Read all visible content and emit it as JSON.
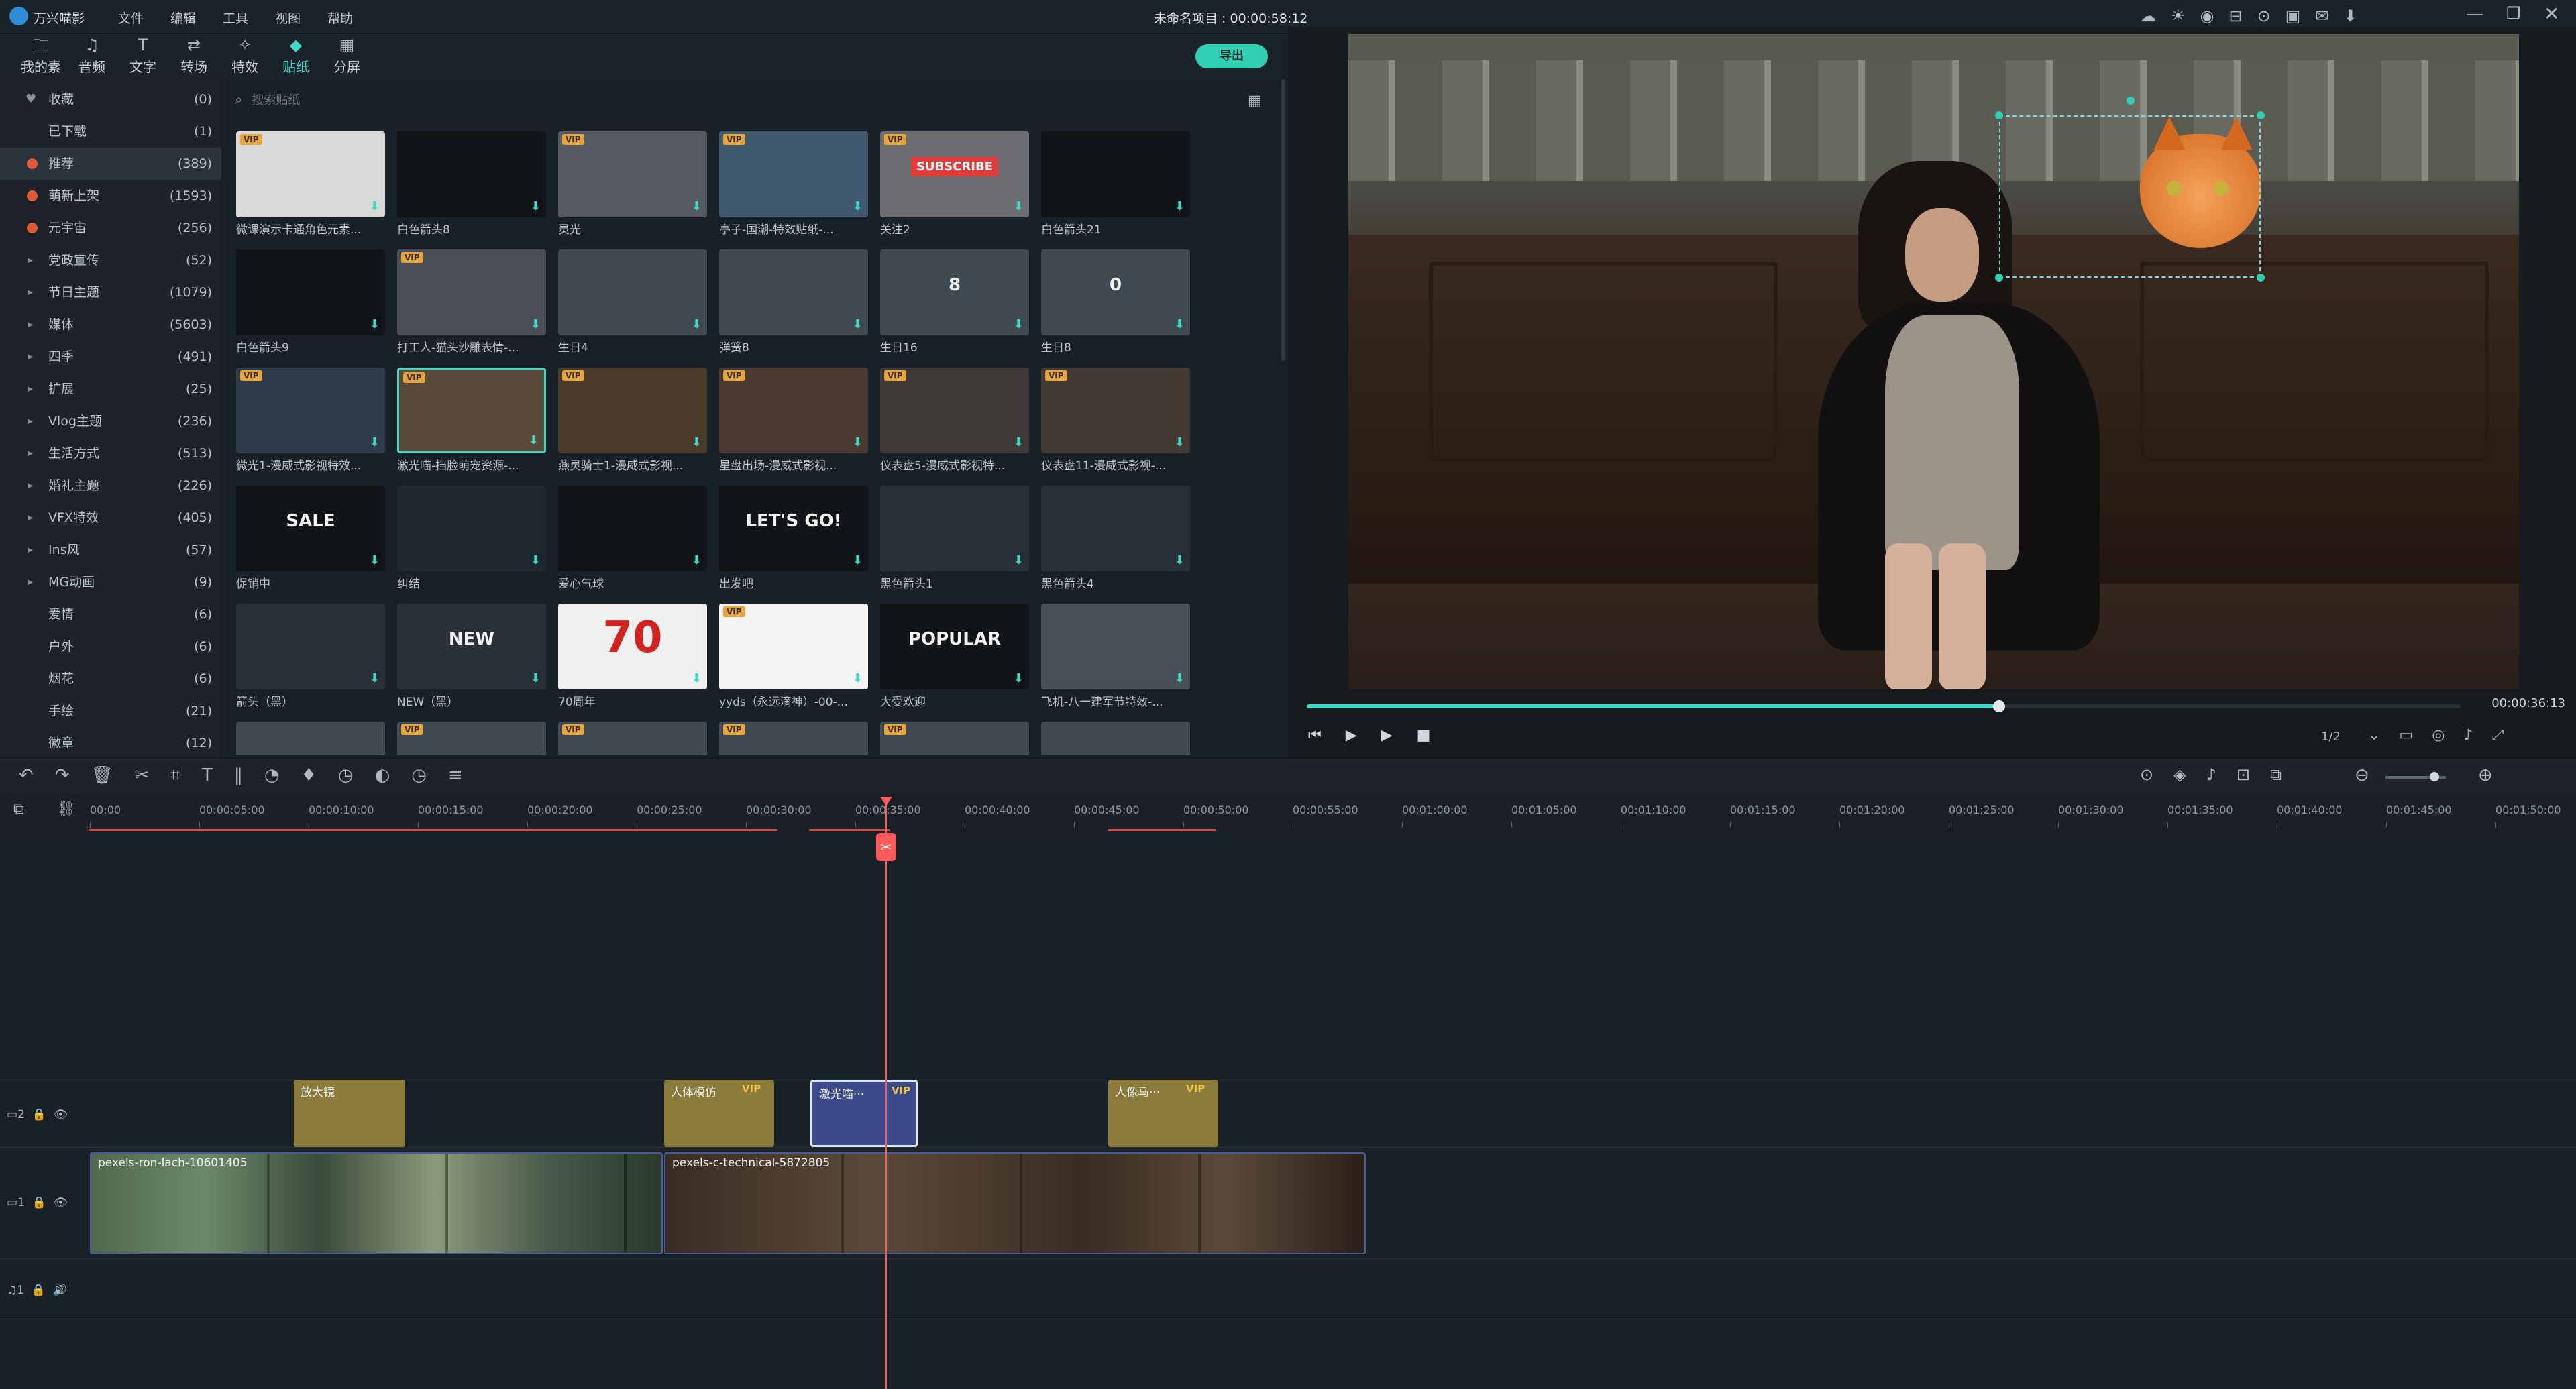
{
  "app": {
    "name": "万兴喵影",
    "project_title": "未命名项目 : 00:00:58:12"
  },
  "menu": [
    "文件",
    "编辑",
    "工具",
    "视图",
    "帮助"
  ],
  "tabs": [
    {
      "label": "我的素材",
      "icon": "folder"
    },
    {
      "label": "音频",
      "icon": "music"
    },
    {
      "label": "文字",
      "icon": "text"
    },
    {
      "label": "转场",
      "icon": "transition"
    },
    {
      "label": "特效",
      "icon": "effects"
    },
    {
      "label": "贴纸",
      "icon": "sticker",
      "active": true
    },
    {
      "label": "分屏",
      "icon": "split"
    }
  ],
  "export_label": "导出",
  "search_placeholder": "搜索贴纸",
  "categories": [
    {
      "label": "收藏",
      "count": "(0)",
      "icon": "heart"
    },
    {
      "label": "已下载",
      "count": "(1)"
    },
    {
      "label": "推荐",
      "count": "(389)",
      "selected": true,
      "icon": "fire"
    },
    {
      "label": "萌新上架",
      "count": "(1593)",
      "icon": "fire"
    },
    {
      "label": "元宇宙",
      "count": "(256)",
      "icon": "fire"
    },
    {
      "label": "党政宣传",
      "count": "(52)",
      "arrow": true
    },
    {
      "label": "节日主题",
      "count": "(1079)",
      "arrow": true
    },
    {
      "label": "媒体",
      "count": "(5603)",
      "arrow": true
    },
    {
      "label": "四季",
      "count": "(491)",
      "arrow": true
    },
    {
      "label": "扩展",
      "count": "(25)",
      "arrow": true
    },
    {
      "label": "Vlog主题",
      "count": "(236)",
      "arrow": true
    },
    {
      "label": "生活方式",
      "count": "(513)",
      "arrow": true
    },
    {
      "label": "婚礼主题",
      "count": "(226)",
      "arrow": true
    },
    {
      "label": "VFX特效",
      "count": "(405)",
      "arrow": true
    },
    {
      "label": "Ins风",
      "count": "(57)",
      "arrow": true
    },
    {
      "label": "MG动画",
      "count": "(9)",
      "arrow": true
    },
    {
      "label": "爱情",
      "count": "(6)"
    },
    {
      "label": "户外",
      "count": "(6)"
    },
    {
      "label": "烟花",
      "count": "(6)"
    },
    {
      "label": "手绘",
      "count": "(21)"
    },
    {
      "label": "徽章",
      "count": "(12)"
    }
  ],
  "stickers": [
    [
      {
        "caption": "微课演示卡通角色元素...",
        "vip": true,
        "bg": "#d9d9d9"
      },
      {
        "caption": "白色箭头8",
        "bg": "#121518"
      },
      {
        "caption": "灵光",
        "vip": true,
        "bg": "#555a60"
      },
      {
        "caption": "亭子-国潮-特效贴纸-...",
        "vip": true,
        "bg": "#3f5a6e"
      },
      {
        "caption": "关注2",
        "vip": true,
        "bg": "#6c6e72",
        "text": "SUBSCRIBE"
      },
      {
        "caption": "白色箭头21",
        "bg": "#121518"
      }
    ],
    [
      {
        "caption": "白色箭头9",
        "bg": "#121518"
      },
      {
        "caption": "打工人-猫头沙雕表情-...",
        "vip": true,
        "bg": "#4a4f55"
      },
      {
        "caption": "生日4",
        "bg": "#3f4a52"
      },
      {
        "caption": "弹簧8",
        "bg": "#3f4a52"
      },
      {
        "caption": "生日16",
        "bg": "#3f4a52",
        "text": "8"
      },
      {
        "caption": "生日8",
        "bg": "#3f4a52",
        "text": "0"
      }
    ],
    [
      {
        "caption": "微光1-漫威式影视特效...",
        "vip": true,
        "bg": "#2e3c4c"
      },
      {
        "caption": "激光喵-挡脸萌宠资源-...",
        "vip": true,
        "bg": "#5a4a3a",
        "selected": true
      },
      {
        "caption": "燕灵骑士1-漫威式影视...",
        "vip": true,
        "bg": "#4a3a2a"
      },
      {
        "caption": "星盘出场-漫威式影视...",
        "vip": true,
        "bg": "#4a3a32"
      },
      {
        "caption": "仪表盘5-漫威式影视特...",
        "vip": true,
        "bg": "#3e3a38"
      },
      {
        "caption": "仪表盘11-漫威式影视-...",
        "vip": true,
        "bg": "#443a34"
      }
    ],
    [
      {
        "caption": "促销中",
        "bg": "#121518",
        "text": "SALE"
      },
      {
        "caption": "纠结",
        "bg": "#1e2830"
      },
      {
        "caption": "爱心气球",
        "bg": "#121518"
      },
      {
        "caption": "出发吧",
        "bg": "#121518",
        "text": "LET'S GO!"
      },
      {
        "caption": "黑色箭头1",
        "bg": "#2a3038"
      },
      {
        "caption": "黑色箭头4",
        "bg": "#2a3038"
      }
    ],
    [
      {
        "caption": "箭头（黑）",
        "bg": "#2a3038"
      },
      {
        "caption": "NEW（黑）",
        "bg": "#2a3038",
        "text": "NEW"
      },
      {
        "caption": "70周年",
        "bg": "#f0f0f0",
        "text": "70"
      },
      {
        "caption": "yyds（永远滴神）-00-...",
        "vip": true,
        "bg": "#f5f5f5"
      },
      {
        "caption": "大受欢迎",
        "bg": "#121518",
        "text": "POPULAR"
      },
      {
        "caption": "飞机-八一建军节特效-...",
        "bg": "#4a5058"
      }
    ],
    [
      {
        "caption": "",
        "bg": "#3f4a52"
      },
      {
        "caption": "",
        "vip": true,
        "bg": "#3f4a52"
      },
      {
        "caption": "",
        "vip": true,
        "bg": "#3f4a52"
      },
      {
        "caption": "",
        "vip": true,
        "bg": "#3f4a52"
      },
      {
        "caption": "",
        "vip": true,
        "bg": "#3f4a52"
      },
      {
        "caption": "",
        "bg": "#3f4a52"
      }
    ]
  ],
  "player": {
    "page": "1/2",
    "current_time": "00:00:36:13",
    "progress": 0.6
  },
  "ruler": [
    "00:00",
    "00:00:05:00",
    "00:00:10:00",
    "00:00:15:00",
    "00:00:20:00",
    "00:00:25:00",
    "00:00:30:00",
    "00:00:35:00",
    "00:00:40:00",
    "00:00:45:00",
    "00:00:50:00",
    "00:00:55:00",
    "00:01:00:00",
    "00:01:05:00",
    "00:01:10:00",
    "00:01:15:00",
    "00:01:20:00",
    "00:01:25:00",
    "00:01:30:00",
    "00:01:35:00",
    "00:01:40:00",
    "00:01:45:00",
    "00:01:50:00"
  ],
  "tracks": {
    "sticker_track_label": "2",
    "video_track_label": "1",
    "audio_track_label": "1",
    "sticker_clips": [
      {
        "label": "放大镜",
        "vip": false
      },
      {
        "label": "人体模仿",
        "vip": true
      },
      {
        "label": "激光喵···",
        "vip": true,
        "selected": true
      },
      {
        "label": "人像马···",
        "vip": true
      }
    ],
    "video_clips": [
      {
        "label": "pexels-ron-lach-10601405"
      },
      {
        "label": "pexels-c-technical-5872805"
      }
    ]
  },
  "vip_label": "VIP",
  "colors": {
    "accent": "#3fd9c6",
    "playhead": "#ff5a5a",
    "sticker_clip": "#8a7a3c",
    "sticker_selected": "#3a4a8a",
    "vip": "#e3a53b"
  }
}
